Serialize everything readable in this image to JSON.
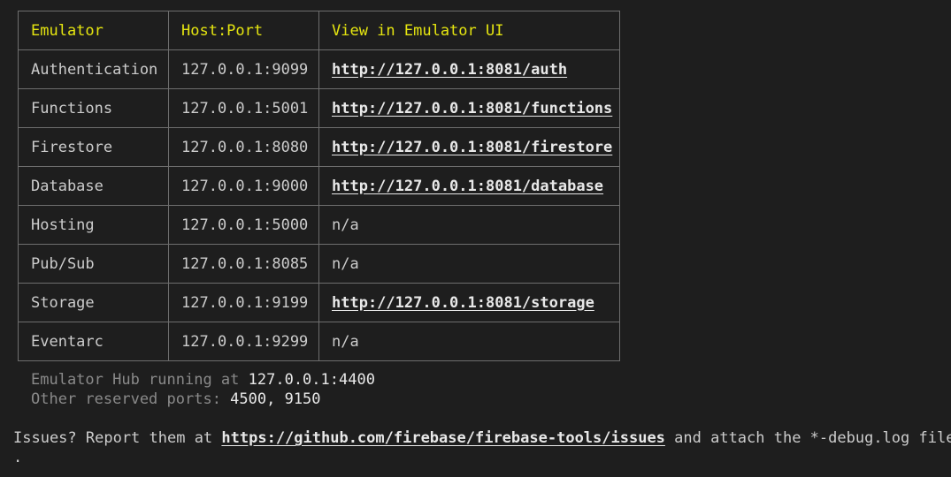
{
  "table": {
    "headers": [
      "Emulator",
      "Host:Port",
      "View in Emulator UI"
    ],
    "rows": [
      {
        "emulator": "Authentication",
        "host_port": "127.0.0.1:9099",
        "ui": "http://127.0.0.1:8081/auth"
      },
      {
        "emulator": "Functions",
        "host_port": "127.0.0.1:5001",
        "ui": "http://127.0.0.1:8081/functions"
      },
      {
        "emulator": "Firestore",
        "host_port": "127.0.0.1:8080",
        "ui": "http://127.0.0.1:8081/firestore"
      },
      {
        "emulator": "Database",
        "host_port": "127.0.0.1:9000",
        "ui": "http://127.0.0.1:8081/database"
      },
      {
        "emulator": "Hosting",
        "host_port": "127.0.0.1:5000",
        "ui": "n/a"
      },
      {
        "emulator": "Pub/Sub",
        "host_port": "127.0.0.1:8085",
        "ui": "n/a"
      },
      {
        "emulator": "Storage",
        "host_port": "127.0.0.1:9199",
        "ui": "http://127.0.0.1:8081/storage"
      },
      {
        "emulator": "Eventarc",
        "host_port": "127.0.0.1:9299",
        "ui": "n/a"
      }
    ]
  },
  "hub": {
    "running_label": "Emulator Hub running at ",
    "running_value": "127.0.0.1:4400",
    "reserved_label": "Other reserved ports: ",
    "reserved_value": "4500, 9150"
  },
  "issues": {
    "prefix": "Issues? Report them at ",
    "url": "https://github.com/firebase/firebase-tools/issues",
    "suffix": " and attach the *-debug.log files",
    "continuation": "."
  },
  "colors": {
    "background": "#1e1e1e",
    "header_text": "#e5e510",
    "text": "#cccccc",
    "dim_text": "#8a8a8a",
    "link_text": "#e8e8e8",
    "border": "#6e6e6e"
  }
}
